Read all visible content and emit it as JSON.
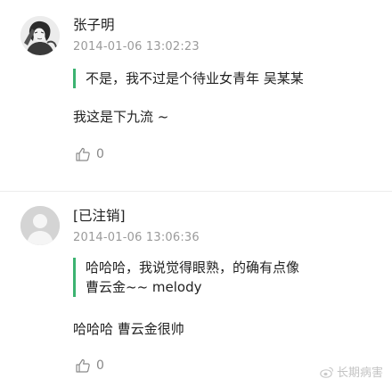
{
  "comments": [
    {
      "author": "张子明",
      "timestamp": "2014-01-06 13:02:23",
      "quote": "不是，我不过是个待业女青年 吴某某",
      "text": "我这是下九流 ~",
      "likes": "0",
      "avatar_icon": "illustrated-portrait-avatar"
    },
    {
      "author": "[已注销]",
      "timestamp": "2014-01-06 13:06:36",
      "quote": "哈哈哈，我说觉得眼熟，的确有点像曹云金~~ melody",
      "text": "哈哈哈 曹云金很帅",
      "likes": "0",
      "avatar_icon": "default-user-avatar"
    }
  ],
  "watermark": {
    "text": "长期病害",
    "icon": "weibo-logo-icon"
  },
  "colors": {
    "quote_bar": "#3cb371",
    "meta_text": "#9a9a9a"
  }
}
